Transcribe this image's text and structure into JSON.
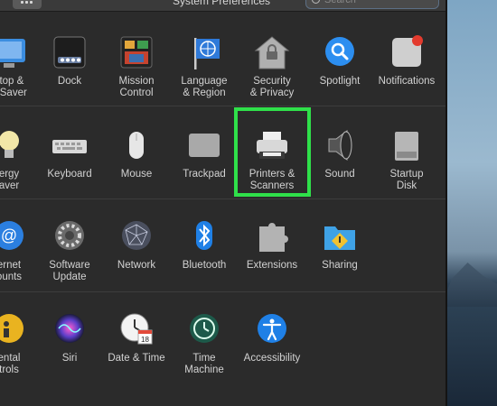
{
  "window": {
    "title": "System Preferences",
    "search_placeholder": "Search"
  },
  "rows": [
    [
      {
        "id": "desktop",
        "label": "ktop &\nn Saver"
      },
      {
        "id": "dock",
        "label": "Dock"
      },
      {
        "id": "mission",
        "label": "Mission\nControl"
      },
      {
        "id": "language",
        "label": "Language\n& Region"
      },
      {
        "id": "security",
        "label": "Security\n& Privacy"
      },
      {
        "id": "spotlight",
        "label": "Spotlight"
      },
      {
        "id": "notifications",
        "label": "Notifications"
      }
    ],
    [
      {
        "id": "energy",
        "label": "ergy\naver"
      },
      {
        "id": "keyboard",
        "label": "Keyboard"
      },
      {
        "id": "mouse",
        "label": "Mouse"
      },
      {
        "id": "trackpad",
        "label": "Trackpad"
      },
      {
        "id": "printers",
        "label": "Printers &\nScanners"
      },
      {
        "id": "sound",
        "label": "Sound"
      },
      {
        "id": "startup",
        "label": "Startup\nDisk"
      }
    ],
    [
      {
        "id": "internet",
        "label": "ernet\nounts"
      },
      {
        "id": "softwareupdate",
        "label": "Software\nUpdate"
      },
      {
        "id": "network",
        "label": "Network"
      },
      {
        "id": "bluetooth",
        "label": "Bluetooth"
      },
      {
        "id": "extensions",
        "label": "Extensions"
      },
      {
        "id": "sharing",
        "label": "Sharing"
      }
    ],
    [
      {
        "id": "parental",
        "label": "ental\ntrols"
      },
      {
        "id": "siri",
        "label": "Siri"
      },
      {
        "id": "datetime",
        "label": "Date & Time"
      },
      {
        "id": "timemachine",
        "label": "Time\nMachine"
      },
      {
        "id": "accessibility",
        "label": "Accessibility"
      }
    ]
  ],
  "colors": {
    "highlight": "#2fe04a",
    "accent": "#1f8cf0"
  }
}
